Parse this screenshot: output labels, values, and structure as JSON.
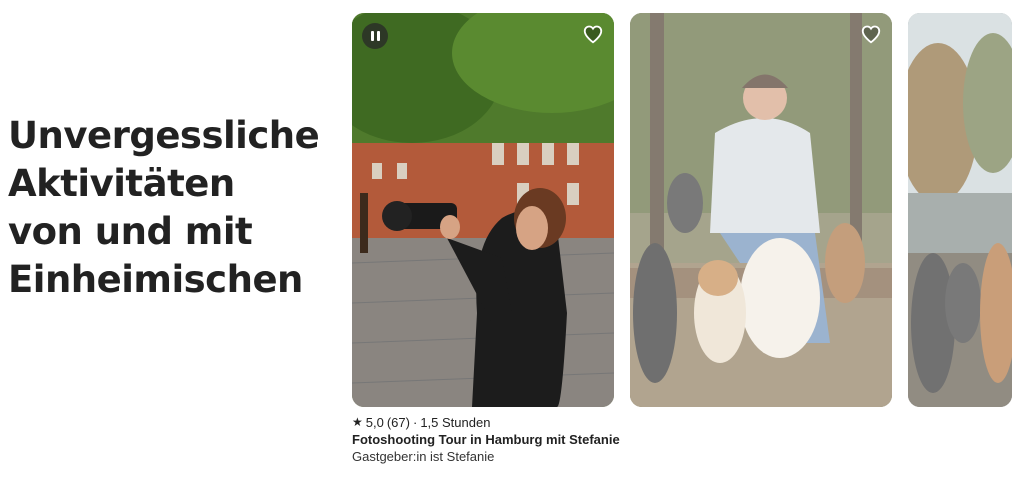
{
  "section": {
    "heading_lines": [
      "Unvergessliche",
      "Aktivitäten",
      "von und mit",
      "Einheimischen"
    ]
  },
  "cards": [
    {
      "rating": "5,0",
      "reviews": "(67)",
      "duration": "1,5 Stunden",
      "title": "Fotoshooting Tour in Hamburg mit Stefanie",
      "host": "Gastgeber:in ist Stefanie",
      "icons": [
        "pause-icon",
        "heart-icon"
      ]
    },
    {
      "icons": [
        "heart-icon"
      ]
    },
    {
      "icons": []
    }
  ],
  "colors": {
    "text": "#222222",
    "heart_outline": "#ffffff"
  }
}
